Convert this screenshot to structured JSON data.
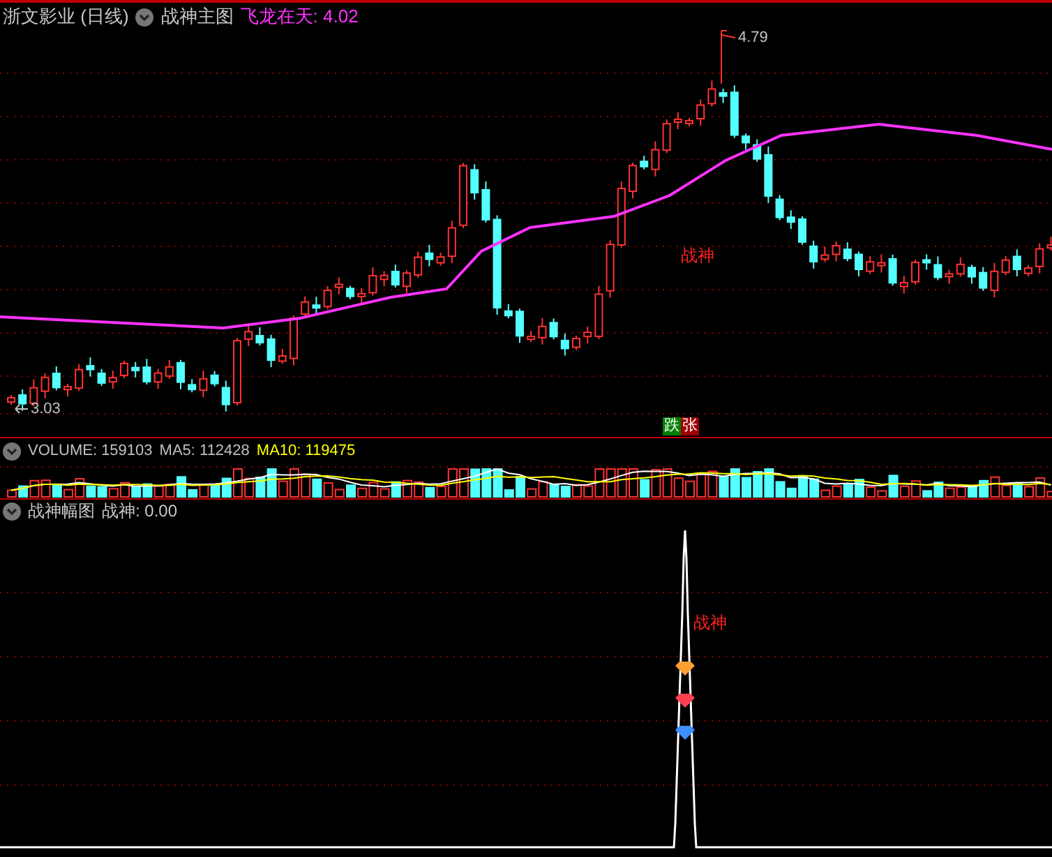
{
  "main_panel": {
    "title": "浙文影业 (日线)",
    "indicator": "战神主图",
    "reading": "飞龙在天: 4.02",
    "high_label": "4.79",
    "low_label": "3.03",
    "signal": "战神",
    "badges": [
      {
        "text": "跌",
        "color": "#008000"
      },
      {
        "text": "张",
        "color": "#a00000"
      }
    ]
  },
  "volume_panel": {
    "readings": [
      {
        "text": "VOLUME: 159103",
        "color": "#c0c0c0"
      },
      {
        "text": "MA5: 112428",
        "color": "#c0c0c0"
      },
      {
        "text": "MA10: 119475",
        "color": "#ffff00"
      }
    ]
  },
  "sub_panel": {
    "indicator": "战神幅图",
    "reading": "战神: 0.00",
    "signal": "战神"
  }
}
